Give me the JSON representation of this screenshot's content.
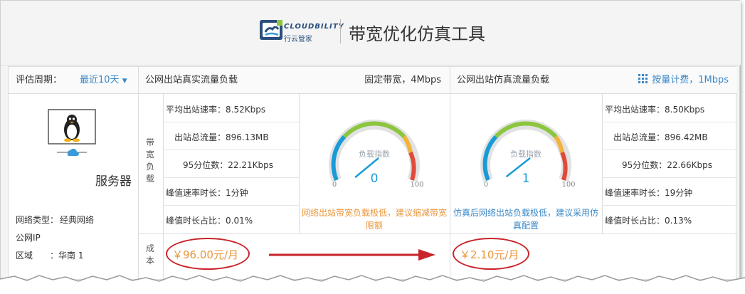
{
  "header": {
    "brand_en": "CLOUDBILITY",
    "brand_cn": "行云管家",
    "title": "带宽优化仿真工具"
  },
  "toolbar": {
    "period_label": "评估周期：",
    "period_value": "最近10天",
    "real_load_title": "公网出站真实流量负载",
    "real_billing": "固定带宽，4Mbps",
    "sim_load_title": "公网出站仿真流量负载",
    "sim_billing": "按量计费，1Mbps"
  },
  "server": {
    "name_suffix": "服务器",
    "network_type_label": "网络类型：",
    "network_type_value": "经典网络",
    "public_ip_label": "公网IP",
    "region_label": "区域",
    "region_value": "华南 1"
  },
  "row_labels": {
    "bandwidth_load": [
      "带",
      "宽",
      "负",
      "载"
    ],
    "cost": [
      "成",
      "本"
    ]
  },
  "real_stats": {
    "avg_rate": "平均出站速率：8.52Kbps",
    "total_traffic": "出站总流量：896.13MB",
    "p95": "95分位数：22.21Kbps",
    "peak_duration": "峰值速率时长：1分钟",
    "peak_ratio": "峰值时长占比：0.01%"
  },
  "sim_stats": {
    "avg_rate": "平均出站速率：8.50Kbps",
    "total_traffic": "出站总流量：896.42MB",
    "p95": "95分位数：22.66Kbps",
    "peak_duration": "峰值速率时长：19分钟",
    "peak_ratio": "峰值时长占比：0.13%"
  },
  "gauges": {
    "title": "负载指数",
    "min_label": "0",
    "max_label": "100",
    "real_value": "0",
    "real_value_num": 0,
    "sim_value": "1",
    "sim_value_num": 1
  },
  "notes": {
    "real": "网络出站带宽负载极低，建议缩减带宽限额",
    "sim": "仿真后网络出站负载极低，建议采用仿真配置"
  },
  "cost": {
    "real": "￥96.00元/月",
    "sim": "￥2.10元/月"
  },
  "colors": {
    "accent_blue": "#3a87c8",
    "warn_orange": "#e8963c",
    "annotation_red": "#c9242b",
    "gauge_green": "#8cc63f",
    "gauge_blue": "#1a9bd7",
    "gauge_red": "#e04a3a"
  },
  "icons": {
    "server": "linux-penguin-monitor-icon",
    "billing": "grid-dots-icon",
    "dropdown": "caret-down-icon"
  }
}
